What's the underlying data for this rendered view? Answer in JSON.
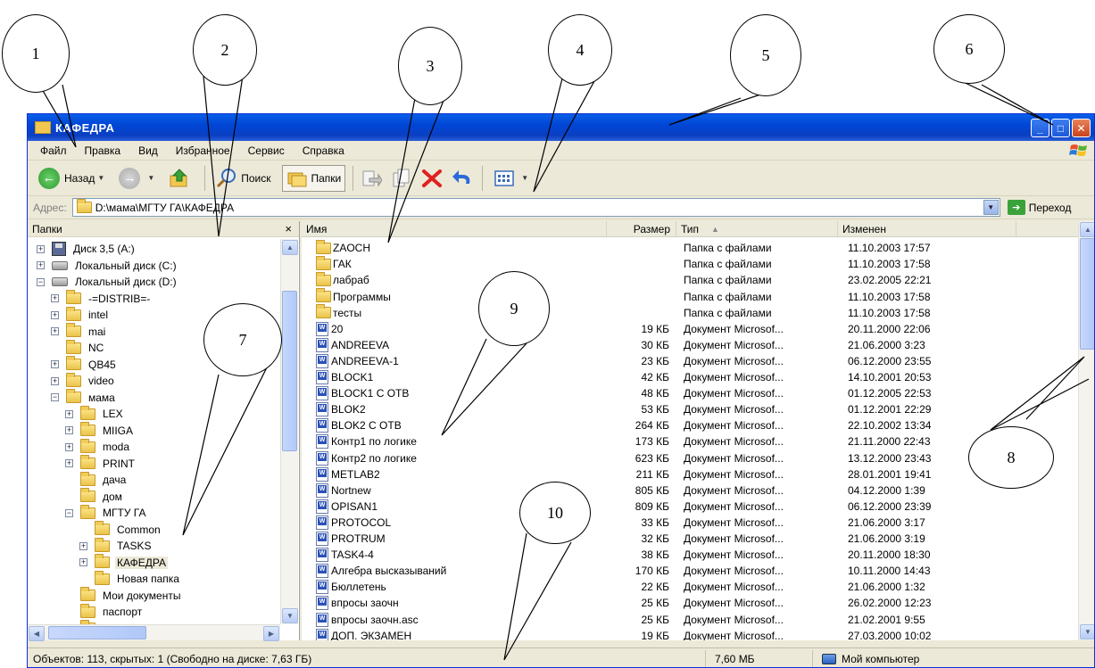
{
  "callouts": [
    "1",
    "2",
    "3",
    "4",
    "5",
    "6",
    "7",
    "8",
    "9",
    "10"
  ],
  "window": {
    "title": "КАФЕДРА"
  },
  "menu": [
    "Файл",
    "Правка",
    "Вид",
    "Избранное",
    "Сервис",
    "Справка"
  ],
  "toolbar": {
    "back": "Назад",
    "search": "Поиск",
    "folders": "Папки"
  },
  "address": {
    "label": "Адрес:",
    "path": "D:\\мама\\МГТУ ГА\\КАФЕДРА",
    "go": "Переход"
  },
  "folder_pane": {
    "title": "Папки",
    "close": "×"
  },
  "tree": [
    {
      "level": 1,
      "expander": "+",
      "icon": "floppy",
      "label": "Диск 3,5 (A:)"
    },
    {
      "level": 1,
      "expander": "+",
      "icon": "drive",
      "label": "Локальный диск (C:)"
    },
    {
      "level": 1,
      "expander": "−",
      "icon": "drive",
      "label": "Локальный диск (D:)"
    },
    {
      "level": 2,
      "expander": "+",
      "icon": "folder",
      "label": "-=DISTRIB=-"
    },
    {
      "level": 2,
      "expander": "+",
      "icon": "folder",
      "label": "intel"
    },
    {
      "level": 2,
      "expander": "+",
      "icon": "folder",
      "label": "mai"
    },
    {
      "level": 2,
      "expander": "",
      "icon": "folder",
      "label": "NC"
    },
    {
      "level": 2,
      "expander": "+",
      "icon": "folder",
      "label": "QB45"
    },
    {
      "level": 2,
      "expander": "+",
      "icon": "folder",
      "label": "video"
    },
    {
      "level": 2,
      "expander": "−",
      "icon": "folder",
      "label": "мама"
    },
    {
      "level": 3,
      "expander": "+",
      "icon": "folder",
      "label": "LEX"
    },
    {
      "level": 3,
      "expander": "+",
      "icon": "folder",
      "label": "MIIGA"
    },
    {
      "level": 3,
      "expander": "+",
      "icon": "folder",
      "label": "moda"
    },
    {
      "level": 3,
      "expander": "+",
      "icon": "folder",
      "label": "PRINT"
    },
    {
      "level": 3,
      "expander": "",
      "icon": "folder",
      "label": "дача"
    },
    {
      "level": 3,
      "expander": "",
      "icon": "folder",
      "label": "дом"
    },
    {
      "level": 3,
      "expander": "−",
      "icon": "folder",
      "label": "МГТУ ГА"
    },
    {
      "level": 4,
      "expander": "",
      "icon": "folder",
      "label": "Common"
    },
    {
      "level": 4,
      "expander": "+",
      "icon": "folder",
      "label": "TASKS"
    },
    {
      "level": 4,
      "expander": "+",
      "icon": "folder",
      "label": "КАФЕДРА",
      "selected": true
    },
    {
      "level": 4,
      "expander": "",
      "icon": "folder",
      "label": "Новая папка"
    },
    {
      "level": 3,
      "expander": "",
      "icon": "folder",
      "label": "Мои документы"
    },
    {
      "level": 3,
      "expander": "",
      "icon": "folder",
      "label": "паспорт"
    },
    {
      "level": 3,
      "expander": "",
      "icon": "folder",
      "label": "Протоколы"
    }
  ],
  "columns": {
    "name": "Имя",
    "size": "Размер",
    "type": "Тип",
    "modified": "Изменен"
  },
  "files": [
    {
      "icon": "folder",
      "name": "ZAOCH",
      "size": "",
      "type": "Папка с файлами",
      "date": "11.10.2003 17:57"
    },
    {
      "icon": "folder",
      "name": "ГАК",
      "size": "",
      "type": "Папка с файлами",
      "date": "11.10.2003 17:58"
    },
    {
      "icon": "folder",
      "name": "лабраб",
      "size": "",
      "type": "Папка с файлами",
      "date": "23.02.2005 22:21"
    },
    {
      "icon": "folder",
      "name": "Программы",
      "size": "",
      "type": "Папка с файлами",
      "date": "11.10.2003 17:58"
    },
    {
      "icon": "folder",
      "name": "тесты",
      "size": "",
      "type": "Папка с файлами",
      "date": "11.10.2003 17:58"
    },
    {
      "icon": "doc",
      "name": "20",
      "size": "19 КБ",
      "type": "Документ Microsof...",
      "date": "20.11.2000 22:06"
    },
    {
      "icon": "doc",
      "name": "ANDREEVA",
      "size": "30 КБ",
      "type": "Документ Microsof...",
      "date": "21.06.2000 3:23"
    },
    {
      "icon": "doc",
      "name": "ANDREEVA-1",
      "size": "23 КБ",
      "type": "Документ Microsof...",
      "date": "06.12.2000 23:55"
    },
    {
      "icon": "doc",
      "name": "BLOCK1",
      "size": "42 КБ",
      "type": "Документ Microsof...",
      "date": "14.10.2001 20:53"
    },
    {
      "icon": "doc",
      "name": "BLOCK1 C OTB",
      "size": "48 КБ",
      "type": "Документ Microsof...",
      "date": "01.12.2005 22:53"
    },
    {
      "icon": "doc",
      "name": "BLOK2",
      "size": "53 КБ",
      "type": "Документ Microsof...",
      "date": "01.12.2001 22:29"
    },
    {
      "icon": "doc",
      "name": "BLOK2 C OTB",
      "size": "264 КБ",
      "type": "Документ Microsof...",
      "date": "22.10.2002 13:34"
    },
    {
      "icon": "doc",
      "name": "Контр1 по логике",
      "size": "173 КБ",
      "type": "Документ Microsof...",
      "date": "21.11.2000 22:43"
    },
    {
      "icon": "doc",
      "name": "Контр2 по логике",
      "size": "623 КБ",
      "type": "Документ Microsof...",
      "date": "13.12.2000 23:43"
    },
    {
      "icon": "doc",
      "name": "METLAB2",
      "size": "211 КБ",
      "type": "Документ Microsof...",
      "date": "28.01.2001 19:41"
    },
    {
      "icon": "doc",
      "name": "Nortnew",
      "size": "805 КБ",
      "type": "Документ Microsof...",
      "date": "04.12.2000 1:39"
    },
    {
      "icon": "doc",
      "name": "OPISAN1",
      "size": "809 КБ",
      "type": "Документ Microsof...",
      "date": "06.12.2000 23:39"
    },
    {
      "icon": "doc",
      "name": "PROTOCOL",
      "size": "33 КБ",
      "type": "Документ Microsof...",
      "date": "21.06.2000 3:17"
    },
    {
      "icon": "doc",
      "name": "PROTRUM",
      "size": "32 КБ",
      "type": "Документ Microsof...",
      "date": "21.06.2000 3:19"
    },
    {
      "icon": "doc",
      "name": "TASK4-4",
      "size": "38 КБ",
      "type": "Документ Microsof...",
      "date": "20.11.2000 18:30"
    },
    {
      "icon": "doc",
      "name": "Алгебра высказываний",
      "size": "170 КБ",
      "type": "Документ Microsof...",
      "date": "10.11.2000 14:43"
    },
    {
      "icon": "doc",
      "name": "Бюллетень",
      "size": "22 КБ",
      "type": "Документ Microsof...",
      "date": "21.06.2000 1:32"
    },
    {
      "icon": "doc",
      "name": "впросы заочн",
      "size": "25 КБ",
      "type": "Документ Microsof...",
      "date": "26.02.2000 12:23"
    },
    {
      "icon": "doc",
      "name": "впросы заочн.asc",
      "size": "25 КБ",
      "type": "Документ Microsof...",
      "date": "21.02.2001 9:55"
    },
    {
      "icon": "doc",
      "name": "ДОП. ЭКЗАМЕН",
      "size": "19 КБ",
      "type": "Документ Microsof...",
      "date": "27.03.2000 10:02"
    }
  ],
  "status": {
    "objects": "Объектов: 113, скрытых: 1 (Свободно на диске: 7,63 ГБ)",
    "size": "7,60 МБ",
    "location": "Мой компьютер"
  }
}
